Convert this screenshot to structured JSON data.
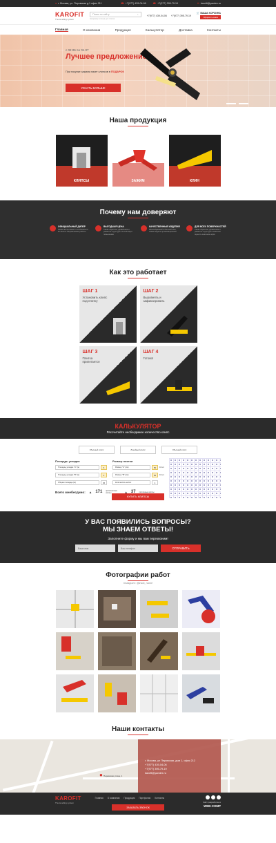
{
  "topbar": {
    "address": "г. Москва, ул. Перовская д.1 офис 211",
    "phone1": "+7(977) 439-04-06",
    "phone2": "+7(977) 395-79-19",
    "email": "karofit@yandex.ru"
  },
  "header": {
    "brand": "KAROFIT",
    "tagline": "The levelling system",
    "search_placeholder": "Поиск по сайту",
    "search_hint": "Например: клинья для плитки",
    "phone1": "+7(977) 439-04-06",
    "phone2": "+7(977) 395-79-19",
    "cart_label": "ВАША КОРЗИНА",
    "cart_button": "Оформить заказ"
  },
  "nav": [
    "Главная",
    "О компании",
    "Продукция",
    "Калькулятор",
    "Доставка",
    "Контакты"
  ],
  "hero": {
    "date": "с 02.06 по 01.07",
    "title": "Лучшее предложение!",
    "desc_prefix": "При покупке зажима пакет клипсов в ",
    "desc_accent": "ПОДАРОК",
    "button": "УЗНАТЬ БОЛЬШЕ"
  },
  "products": {
    "title": "Наша продукция",
    "items": [
      "КЛИПСЫ",
      "ЗАЖИМ",
      "КЛИН"
    ]
  },
  "trust": {
    "title": "Почему нам доверяют",
    "items": [
      {
        "t": "ОФИЦИАЛЬНЫЙ ДИЛЕР",
        "d": "Знаем ассортимент и особенности во многих направлениях работы"
      },
      {
        "t": "ВЫГОДНАЯ ЦЕНА",
        "d": "Также обратное управление и развитие структуры способствует повышению"
      },
      {
        "t": "КАЧЕСТВЕННЫЕ ИЗДЕЛИЯ",
        "d": "Разнообразный и богатый опыт новая модель организационной"
      },
      {
        "t": "ДЛЯ ВСЕХ ПОВЕРХНОСТЕЙ",
        "d": "Также обратное управление и развитие структуры позволяет оценить значение норм"
      }
    ]
  },
  "how": {
    "title": "Как это работает",
    "steps": [
      {
        "step": "ШАГ 1",
        "text": "Установить клипс под плитку"
      },
      {
        "step": "ШАГ 2",
        "text": "Выровнять и зафиксировать"
      },
      {
        "step": "ШАГ 3",
        "text": "Плитка прилегается"
      },
      {
        "step": "ШАГ 4",
        "text": "Готово!"
      }
    ]
  },
  "calc": {
    "title": "КАЛЬКУЛЯТОР",
    "subtitle": "Рассчитайте необходимое количество клипс",
    "tabs": [
      "Обычный клипс",
      "Линейный клипс",
      "Обычный клипс"
    ],
    "area_head": "Площадь укладки",
    "size_head": "Размер плитки",
    "area_rows": [
      {
        "label": "Площадь укладки \"А\" (м)",
        "value": "6"
      },
      {
        "label": "Площадь укладки \"В\" (м)",
        "value": "4"
      },
      {
        "label": "Общая площадь (м²)",
        "value": "25"
      }
    ],
    "size_rows": [
      {
        "label": "Размер \"А\" (см)",
        "value": "50",
        "unit": "10 шт"
      },
      {
        "label": "Размер \"В\" (см)",
        "value": "50",
        "unit": "10 шт"
      },
      {
        "label": "Количество на 1м²",
        "value": "4",
        "unit": ""
      }
    ],
    "total_label": "Всего мнебесдино:",
    "total1": "171",
    "total1_note": "краткосрочные клипсы",
    "total2": "37",
    "total2_note": "постоянные клипсы",
    "buy": "КУПИТЬ КЛИПСЫ"
  },
  "questions": {
    "title_line1": "У ВАС ПОЯВИЛИСЬ ВОПРОСЫ?",
    "title_line2": "МЫ ЗНАЕМ ОТВЕТЫ!",
    "subtitle": "Заполните форму и мы вам перезвоним!",
    "name_placeholder": "Ваше имя",
    "phone_placeholder": "Ваш телефон",
    "send": "ОТПРАВИТЬ"
  },
  "photos": {
    "title": "Фотографии работ",
    "instagram": "Instagram: @inzla_name"
  },
  "contacts": {
    "title": "Наши контакты",
    "address": "г. Москва, ул Перовская, дом 1, офис 212",
    "phone1": "+7(977) 439-04-06",
    "phone2": "+7(977) 395-79-19",
    "email": "karofit@yandex.ru",
    "map_label": "Перовская улица, 1"
  },
  "footer": {
    "brand": "KAROFIT",
    "tagline": "The levelling system",
    "links": [
      "Главная",
      "О компании",
      "Продукция",
      "Портфолио",
      "Контакты"
    ],
    "call": "ЗАКАЗАТЬ ЗВОНОК",
    "dev_label": "Сайт разработан в",
    "dev": "WEB-COMP"
  },
  "colors": {
    "accent": "#d8302a",
    "dark": "#2b2b2b"
  }
}
